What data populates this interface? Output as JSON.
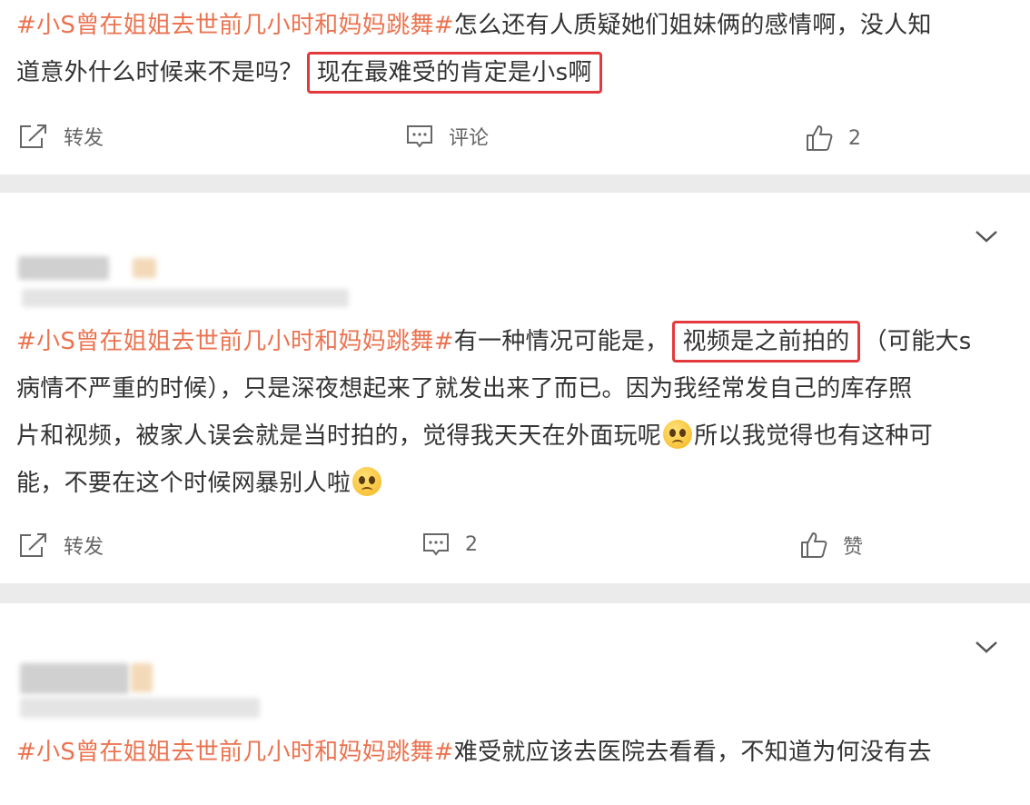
{
  "posts": [
    {
      "topic": "#小S曾在姐姐去世前几小时和妈妈跳舞#",
      "line1_rest": "怎么还有人质疑她们姐妹俩的感情啊，没人知",
      "line2_pre": "道意外什么时候来不是吗？",
      "highlight": "现在最难受的肯定是小s啊",
      "actions": {
        "repost": "转发",
        "comment": "评论",
        "like": "2"
      }
    },
    {
      "topic": "#小S曾在姐姐去世前几小时和妈妈跳舞#",
      "line1_mid": "有一种情况可能是，",
      "highlight": "视频是之前拍的",
      "line1_post": "（可能大s",
      "line2": "病情不严重的时候），只是深夜想起来了就发出来了而已。因为我经常发自己的库存照",
      "line3_pre": "片和视频，被家人误会就是当时拍的，觉得我天天在外面玩呢",
      "line3_post": "所以我觉得也有这种可",
      "line4": "能，不要在这个时候网暴别人啦",
      "actions": {
        "repost": "转发",
        "comment": "2",
        "like": "赞"
      }
    },
    {
      "topic": "#小S曾在姐姐去世前几小时和妈妈跳舞#",
      "line1_rest": "难受就应该去医院去看看，不知道为何没有去"
    }
  ],
  "icons": [
    "repost-icon",
    "comment-icon",
    "like-icon",
    "chevron-down-icon",
    "sad-emoji-icon"
  ],
  "colors": {
    "topic": "#eb7350",
    "highlight_border": "#e4393c",
    "background": "#ebebeb"
  }
}
